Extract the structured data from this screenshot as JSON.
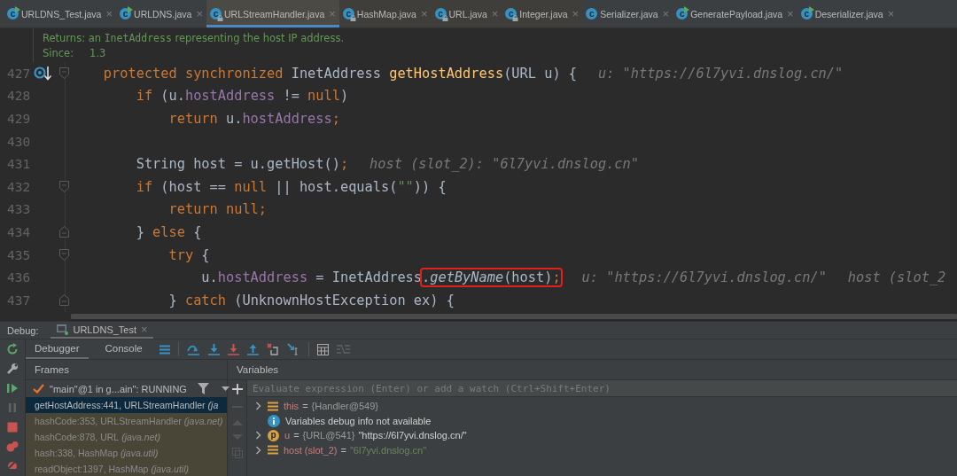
{
  "tabs": [
    {
      "label": "URLDNS_Test.java",
      "kind": "runnable",
      "icon_letter": "c",
      "selected": false,
      "close": "×"
    },
    {
      "label": "URLDNS.java",
      "kind": "runnable",
      "icon_letter": "c",
      "selected": false,
      "close": "×"
    },
    {
      "label": "URLStreamHandler.java",
      "kind": "library",
      "icon_letter": "c",
      "selected": true,
      "close": "×"
    },
    {
      "label": "HashMap.java",
      "kind": "library",
      "icon_letter": "c",
      "selected": false,
      "close": "×"
    },
    {
      "label": "URL.java",
      "kind": "library",
      "icon_letter": "c",
      "selected": false,
      "close": "×"
    },
    {
      "label": "Integer.java",
      "kind": "library",
      "icon_letter": "c",
      "selected": false,
      "close": "×"
    },
    {
      "label": "Serializer.java",
      "kind": "class",
      "icon_letter": "c",
      "selected": false,
      "close": "×"
    },
    {
      "label": "GeneratePayload.java",
      "kind": "runnable",
      "icon_letter": "c",
      "selected": false,
      "close": "×"
    },
    {
      "label": "Deserializer.java",
      "kind": "runnable",
      "icon_letter": "c",
      "selected": false,
      "close": "×"
    }
  ],
  "doc": {
    "returns": [
      {
        "kind": "text",
        "text": "Returns: an "
      },
      {
        "kind": "code",
        "text": "InetAddress"
      },
      {
        "kind": "text",
        "text": " representing the host IP address."
      }
    ],
    "since_label": "Since:",
    "since_value": "1.3"
  },
  "code_lines": [
    {
      "number": "427",
      "gutter": [
        {
          "kind": "breakpoint-arrow"
        },
        {
          "kind": "fold-start"
        }
      ],
      "tokens": [
        {
          "kind": "kw",
          "text": "    protected synchronized "
        },
        {
          "kind": "plain",
          "text": "InetAddress "
        },
        {
          "kind": "method",
          "text": "getHostAddress"
        },
        {
          "kind": "plain",
          "text": "(URL u) {"
        }
      ],
      "hints": [
        "u: \"https://6l7yvi.dnslog.cn/\""
      ]
    },
    {
      "number": "428",
      "tokens": [
        {
          "kind": "kw",
          "text": "        if "
        },
        {
          "kind": "plain",
          "text": "(u."
        },
        {
          "kind": "field",
          "text": "hostAddress"
        },
        {
          "kind": "plain",
          "text": " != "
        },
        {
          "kind": "kw",
          "text": "null"
        },
        {
          "kind": "plain",
          "text": ")"
        }
      ]
    },
    {
      "number": "429",
      "tokens": [
        {
          "kind": "kw",
          "text": "            return "
        },
        {
          "kind": "plain",
          "text": "u."
        },
        {
          "kind": "field",
          "text": "hostAddress"
        },
        {
          "kind": "kw",
          "text": ";"
        }
      ]
    },
    {
      "number": "430"
    },
    {
      "number": "431",
      "tokens": [
        {
          "kind": "plain",
          "text": "        String host = u.getHost()"
        },
        {
          "kind": "kw",
          "text": ";"
        }
      ],
      "hints": [
        "host (slot_2): \"6l7yvi.dnslog.cn\""
      ]
    },
    {
      "number": "432",
      "gutter": [
        {
          "kind": "fold-start"
        }
      ],
      "tokens": [
        {
          "kind": "kw",
          "text": "        if "
        },
        {
          "kind": "plain",
          "text": "(host == "
        },
        {
          "kind": "kw",
          "text": "null"
        },
        {
          "kind": "plain",
          "text": " || host.equals("
        },
        {
          "kind": "str",
          "text": "\"\""
        },
        {
          "kind": "plain",
          "text": ")) {"
        }
      ]
    },
    {
      "number": "433",
      "tokens": [
        {
          "kind": "kw",
          "text": "            return null;"
        }
      ]
    },
    {
      "number": "434",
      "gutter": [
        {
          "kind": "fold-end"
        }
      ],
      "tokens": [
        {
          "kind": "plain",
          "text": "        } "
        },
        {
          "kind": "kw",
          "text": "else"
        },
        {
          "kind": "plain",
          "text": " {"
        }
      ]
    },
    {
      "number": "435",
      "gutter": [
        {
          "kind": "fold-start"
        }
      ],
      "tokens": [
        {
          "kind": "kw",
          "text": "            try"
        },
        {
          "kind": "plain",
          "text": " {"
        }
      ]
    },
    {
      "number": "436",
      "tokens": [
        {
          "kind": "plain",
          "text": "                u."
        },
        {
          "kind": "field",
          "text": "hostAddress"
        },
        {
          "kind": "plain",
          "text": " = InetAddress"
        },
        {
          "kind": "group",
          "outlined": true,
          "tokens": [
            {
              "kind": "plain",
              "text": "."
            },
            {
              "kind": "italic",
              "text": "getByName"
            },
            {
              "kind": "plain",
              "text": "(host)"
            },
            {
              "kind": "kw",
              "text": ";"
            }
          ]
        }
      ],
      "hints": [
        "u: \"https://6l7yvi.dnslog.cn/\"",
        "host (slot_2"
      ]
    },
    {
      "number": "437",
      "gutter": [
        {
          "kind": "fold-end"
        }
      ],
      "tokens": [
        {
          "kind": "plain",
          "text": "            } "
        },
        {
          "kind": "kw",
          "text": "catch"
        },
        {
          "kind": "plain",
          "text": " (UnknownHostException ex) {"
        }
      ]
    }
  ],
  "debug": {
    "label": "Debug:",
    "session": {
      "label": "URLDNS_Test",
      "close": "×",
      "selected": true
    },
    "tabs": [
      {
        "label": "Debugger",
        "selected": true
      },
      {
        "label": "Console",
        "selected": false
      }
    ],
    "frames_header": "Frames",
    "variables_header": "Variables",
    "thread": "\"main\"@1 in g...ain\": RUNNING",
    "frames": [
      {
        "location": "getHostAddress:441, URLStreamHandler",
        "package": "(ja",
        "selected": true,
        "library": false
      },
      {
        "location": "hashCode:353, URLStreamHandler",
        "package": "(java.net)",
        "selected": false,
        "library": true
      },
      {
        "location": "hashCode:878, URL",
        "package": "(java.net)",
        "selected": false,
        "library": true
      },
      {
        "location": "hash:338, HashMap",
        "package": "(java.util)",
        "selected": false,
        "library": true
      },
      {
        "location": "readObject:1397, HashMap",
        "package": "(java.util)",
        "selected": false,
        "library": true
      }
    ],
    "watch_placeholder": "Evaluate expression (Enter) or add a watch (Ctrl+Shift+Enter)",
    "variables": [
      {
        "kind": "field",
        "expanded": false,
        "parts": [
          {
            "kind": "name",
            "text": "this"
          },
          {
            "kind": "eq",
            "text": "="
          },
          {
            "kind": "ref",
            "text": "{Handler@549}"
          }
        ]
      },
      {
        "kind": "info",
        "parts": [
          {
            "kind": "value",
            "text": "Variables debug info not available"
          }
        ]
      },
      {
        "kind": "param",
        "icon_letter": "p",
        "expanded": false,
        "parts": [
          {
            "kind": "name",
            "text": "u"
          },
          {
            "kind": "eq",
            "text": "="
          },
          {
            "kind": "ref",
            "text": "{URL@541}"
          },
          {
            "kind": "value",
            "text": "\"https://6l7yvi.dnslog.cn/\""
          }
        ]
      },
      {
        "kind": "field",
        "expanded": false,
        "parts": [
          {
            "kind": "name",
            "text": "host (slot_2)"
          },
          {
            "kind": "eq",
            "text": "="
          },
          {
            "kind": "string",
            "text": "\"6l7yvi.dnslog.cn\""
          }
        ]
      }
    ]
  }
}
